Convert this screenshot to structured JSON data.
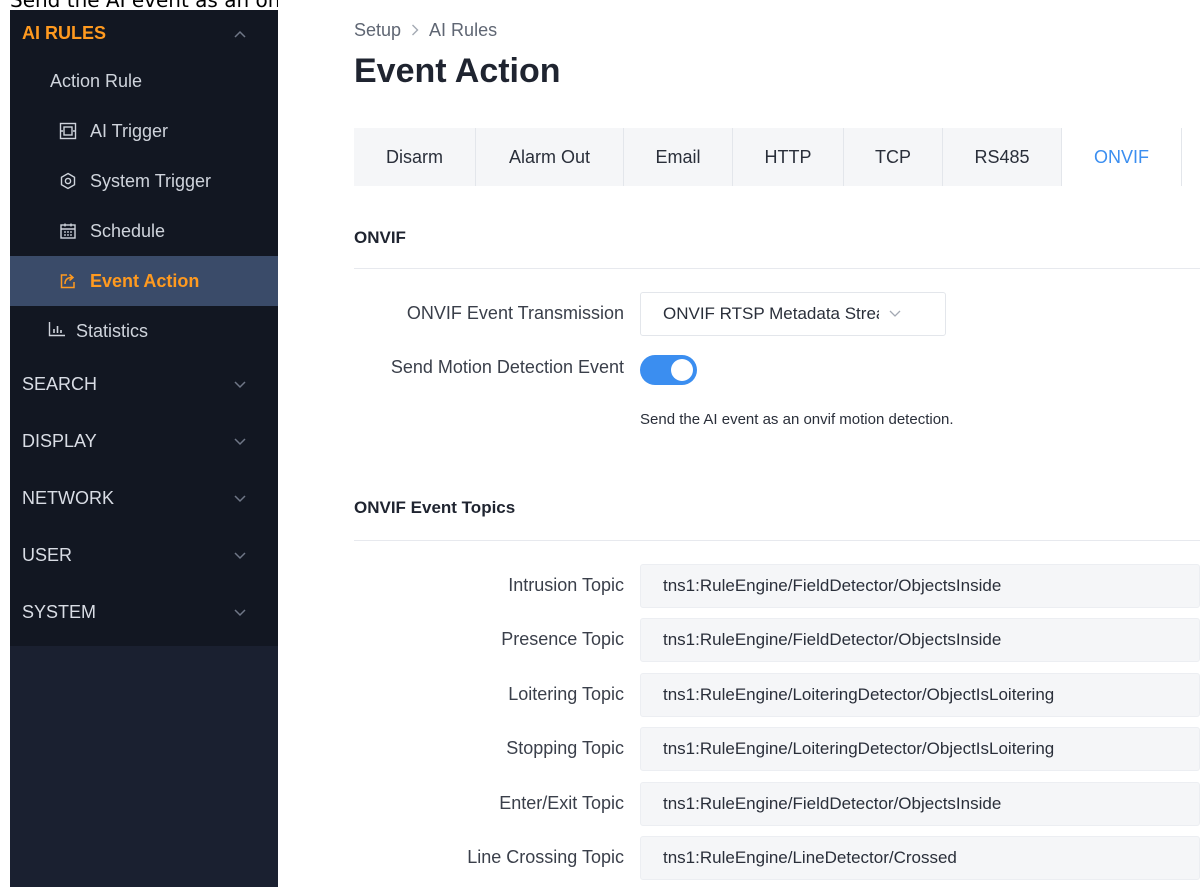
{
  "caption": "Send the AI event as an onvif motion detection (OK)",
  "sidebar": {
    "sections": [
      {
        "label": "AI RULES",
        "chevron": "chevron-up-icon"
      },
      {
        "label": "SEARCH",
        "chevron": "chevron-down-icon"
      },
      {
        "label": "DISPLAY",
        "chevron": "chevron-down-icon"
      },
      {
        "label": "NETWORK",
        "chevron": "chevron-down-icon"
      },
      {
        "label": "USER",
        "chevron": "chevron-down-icon"
      },
      {
        "label": "SYSTEM",
        "chevron": "chevron-down-icon"
      }
    ],
    "action_rule": "Action Rule",
    "items": [
      {
        "label": "AI Trigger",
        "icon": "ai-trigger-icon"
      },
      {
        "label": "System Trigger",
        "icon": "gear-icon"
      },
      {
        "label": "Schedule",
        "icon": "calendar-icon"
      },
      {
        "label": "Event Action",
        "icon": "share-icon"
      }
    ],
    "statistics": "Statistics",
    "colors": {
      "bg": "#121722",
      "active_bg": "#3a4b69",
      "accent": "#ff9a1f"
    }
  },
  "breadcrumb": {
    "items": [
      "Setup",
      "AI Rules"
    ]
  },
  "page_title": "Event Action",
  "tabs": [
    "Disarm",
    "Alarm Out",
    "Email",
    "HTTP",
    "TCP",
    "RS485",
    "ONVIF"
  ],
  "active_tab": "ONVIF",
  "onvif": {
    "section_title": "ONVIF",
    "transmission_label": "ONVIF Event Transmission",
    "transmission_value": "ONVIF RTSP Metadata Stream",
    "motion_label": "Send Motion Detection Event",
    "motion_enabled": true,
    "motion_hint": "Send the AI event as an onvif motion detection."
  },
  "topics": {
    "section_title": "ONVIF Event Topics",
    "rows": [
      {
        "label": "Intrusion Topic",
        "value": "tns1:RuleEngine/FieldDetector/ObjectsInside"
      },
      {
        "label": "Presence Topic",
        "value": "tns1:RuleEngine/FieldDetector/ObjectsInside"
      },
      {
        "label": "Loitering Topic",
        "value": "tns1:RuleEngine/LoiteringDetector/ObjectIsLoitering"
      },
      {
        "label": "Stopping Topic",
        "value": "tns1:RuleEngine/LoiteringDetector/ObjectIsLoitering"
      },
      {
        "label": "Enter/Exit Topic",
        "value": "tns1:RuleEngine/FieldDetector/ObjectsInside"
      },
      {
        "label": "Line Crossing Topic",
        "value": "tns1:RuleEngine/LineDetector/Crossed"
      }
    ]
  },
  "accent_color": "#3b8ef0"
}
